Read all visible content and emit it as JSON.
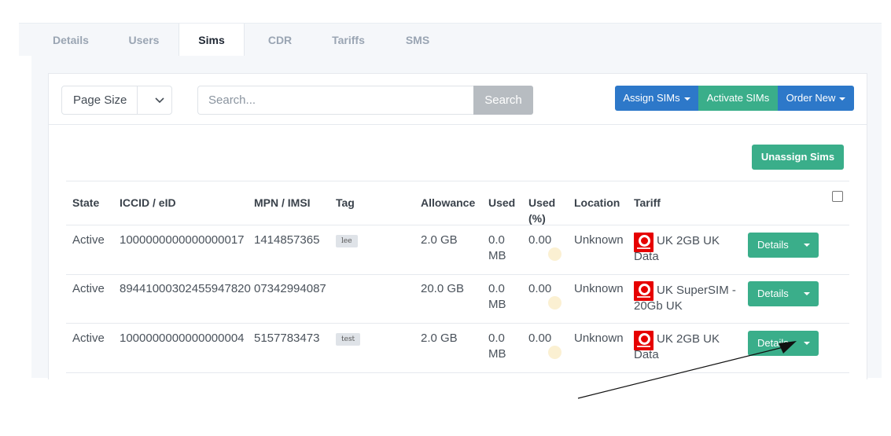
{
  "tabs": [
    {
      "label": "Details"
    },
    {
      "label": "Users"
    },
    {
      "label": "Sims"
    },
    {
      "label": "CDR"
    },
    {
      "label": "Tariffs"
    },
    {
      "label": "SMS"
    }
  ],
  "active_tab": "Sims",
  "toolbar": {
    "page_size_label": "Page Size",
    "search_placeholder": "Search...",
    "search_button": "Search",
    "assign_sims": "Assign SIMs",
    "activate_sims": "Activate SIMs",
    "order_new": "Order New",
    "unassign_sims": "Unassign Sims"
  },
  "table": {
    "headers": {
      "state": "State",
      "iccid": "ICCID / eID",
      "mpn": "MPN / IMSI",
      "tag": "Tag",
      "allowance": "Allowance",
      "used": "Used",
      "used_pct_1": "Used",
      "used_pct_2": "(%)",
      "location": "Location",
      "tariff": "Tariff"
    },
    "rows": [
      {
        "state": "Active",
        "iccid": "1000000000000000017",
        "mpn": "1414857365",
        "tag": "lee",
        "allowance": "2.0 GB",
        "used_1": "0.0",
        "used_2": "MB",
        "used_pct": "0.00",
        "location": "Unknown",
        "tariff": "UK 2GB UK Data",
        "action": "Details"
      },
      {
        "state": "Active",
        "iccid": "89441000302455947820",
        "mpn": "07342994087",
        "tag": "",
        "allowance": "20.0 GB",
        "used_1": "0.0",
        "used_2": "MB",
        "used_pct": "0.00",
        "location": "Unknown",
        "tariff": "UK SuperSIM - 20Gb UK",
        "action": "Details"
      },
      {
        "state": "Active",
        "iccid": "1000000000000000004",
        "mpn": "5157783473",
        "tag": "test",
        "allowance": "2.0 GB",
        "used_1": "0.0",
        "used_2": "MB",
        "used_pct": "0.00",
        "location": "Unknown",
        "tariff": "UK 2GB UK Data",
        "action": "Details"
      }
    ]
  },
  "icons": {
    "tariff_logo": "vodafone-logo-icon",
    "dropdown": "chevron-down-icon",
    "caret": "caret-down-icon"
  },
  "colors": {
    "primary_blue": "#2d78c9",
    "success_green": "#3aae8a",
    "vodafone_red": "#e60000",
    "search_gray": "#b7bcc1"
  }
}
